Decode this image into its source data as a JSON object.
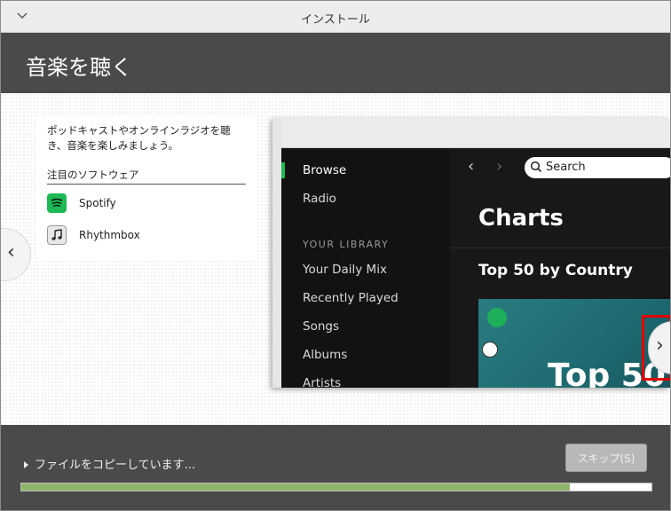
{
  "window": {
    "title": "インストール",
    "menu_icon": "chevron-down-icon"
  },
  "header": {
    "title": "音楽を聴く"
  },
  "panel": {
    "description": "ポッドキャストやオンラインラジオを聴き、音楽を楽しみましょう。",
    "featured_label": "注目のソフトウェア",
    "apps": [
      {
        "name": "Spotify",
        "icon": "spotify-icon",
        "color": "#1db954"
      },
      {
        "name": "Rhythmbox",
        "icon": "music-note-icon"
      }
    ]
  },
  "screenshot": {
    "sidebar": {
      "items": [
        "Browse",
        "Radio"
      ],
      "library_heading": "YOUR LIBRARY",
      "library_items": [
        "Your Daily Mix",
        "Recently Played",
        "Songs",
        "Albums",
        "Artists"
      ]
    },
    "search_placeholder": "Search",
    "page_title": "Charts",
    "section_title": "Top 50 by Country",
    "card_text": "Top 50"
  },
  "footer": {
    "status": "ファイルをコピーしています...",
    "skip_label": "スキップ(S)",
    "progress": 0.87
  },
  "colors": {
    "accent": "#1db954",
    "progress": "#8fb56b",
    "highlight": "#e00000"
  }
}
